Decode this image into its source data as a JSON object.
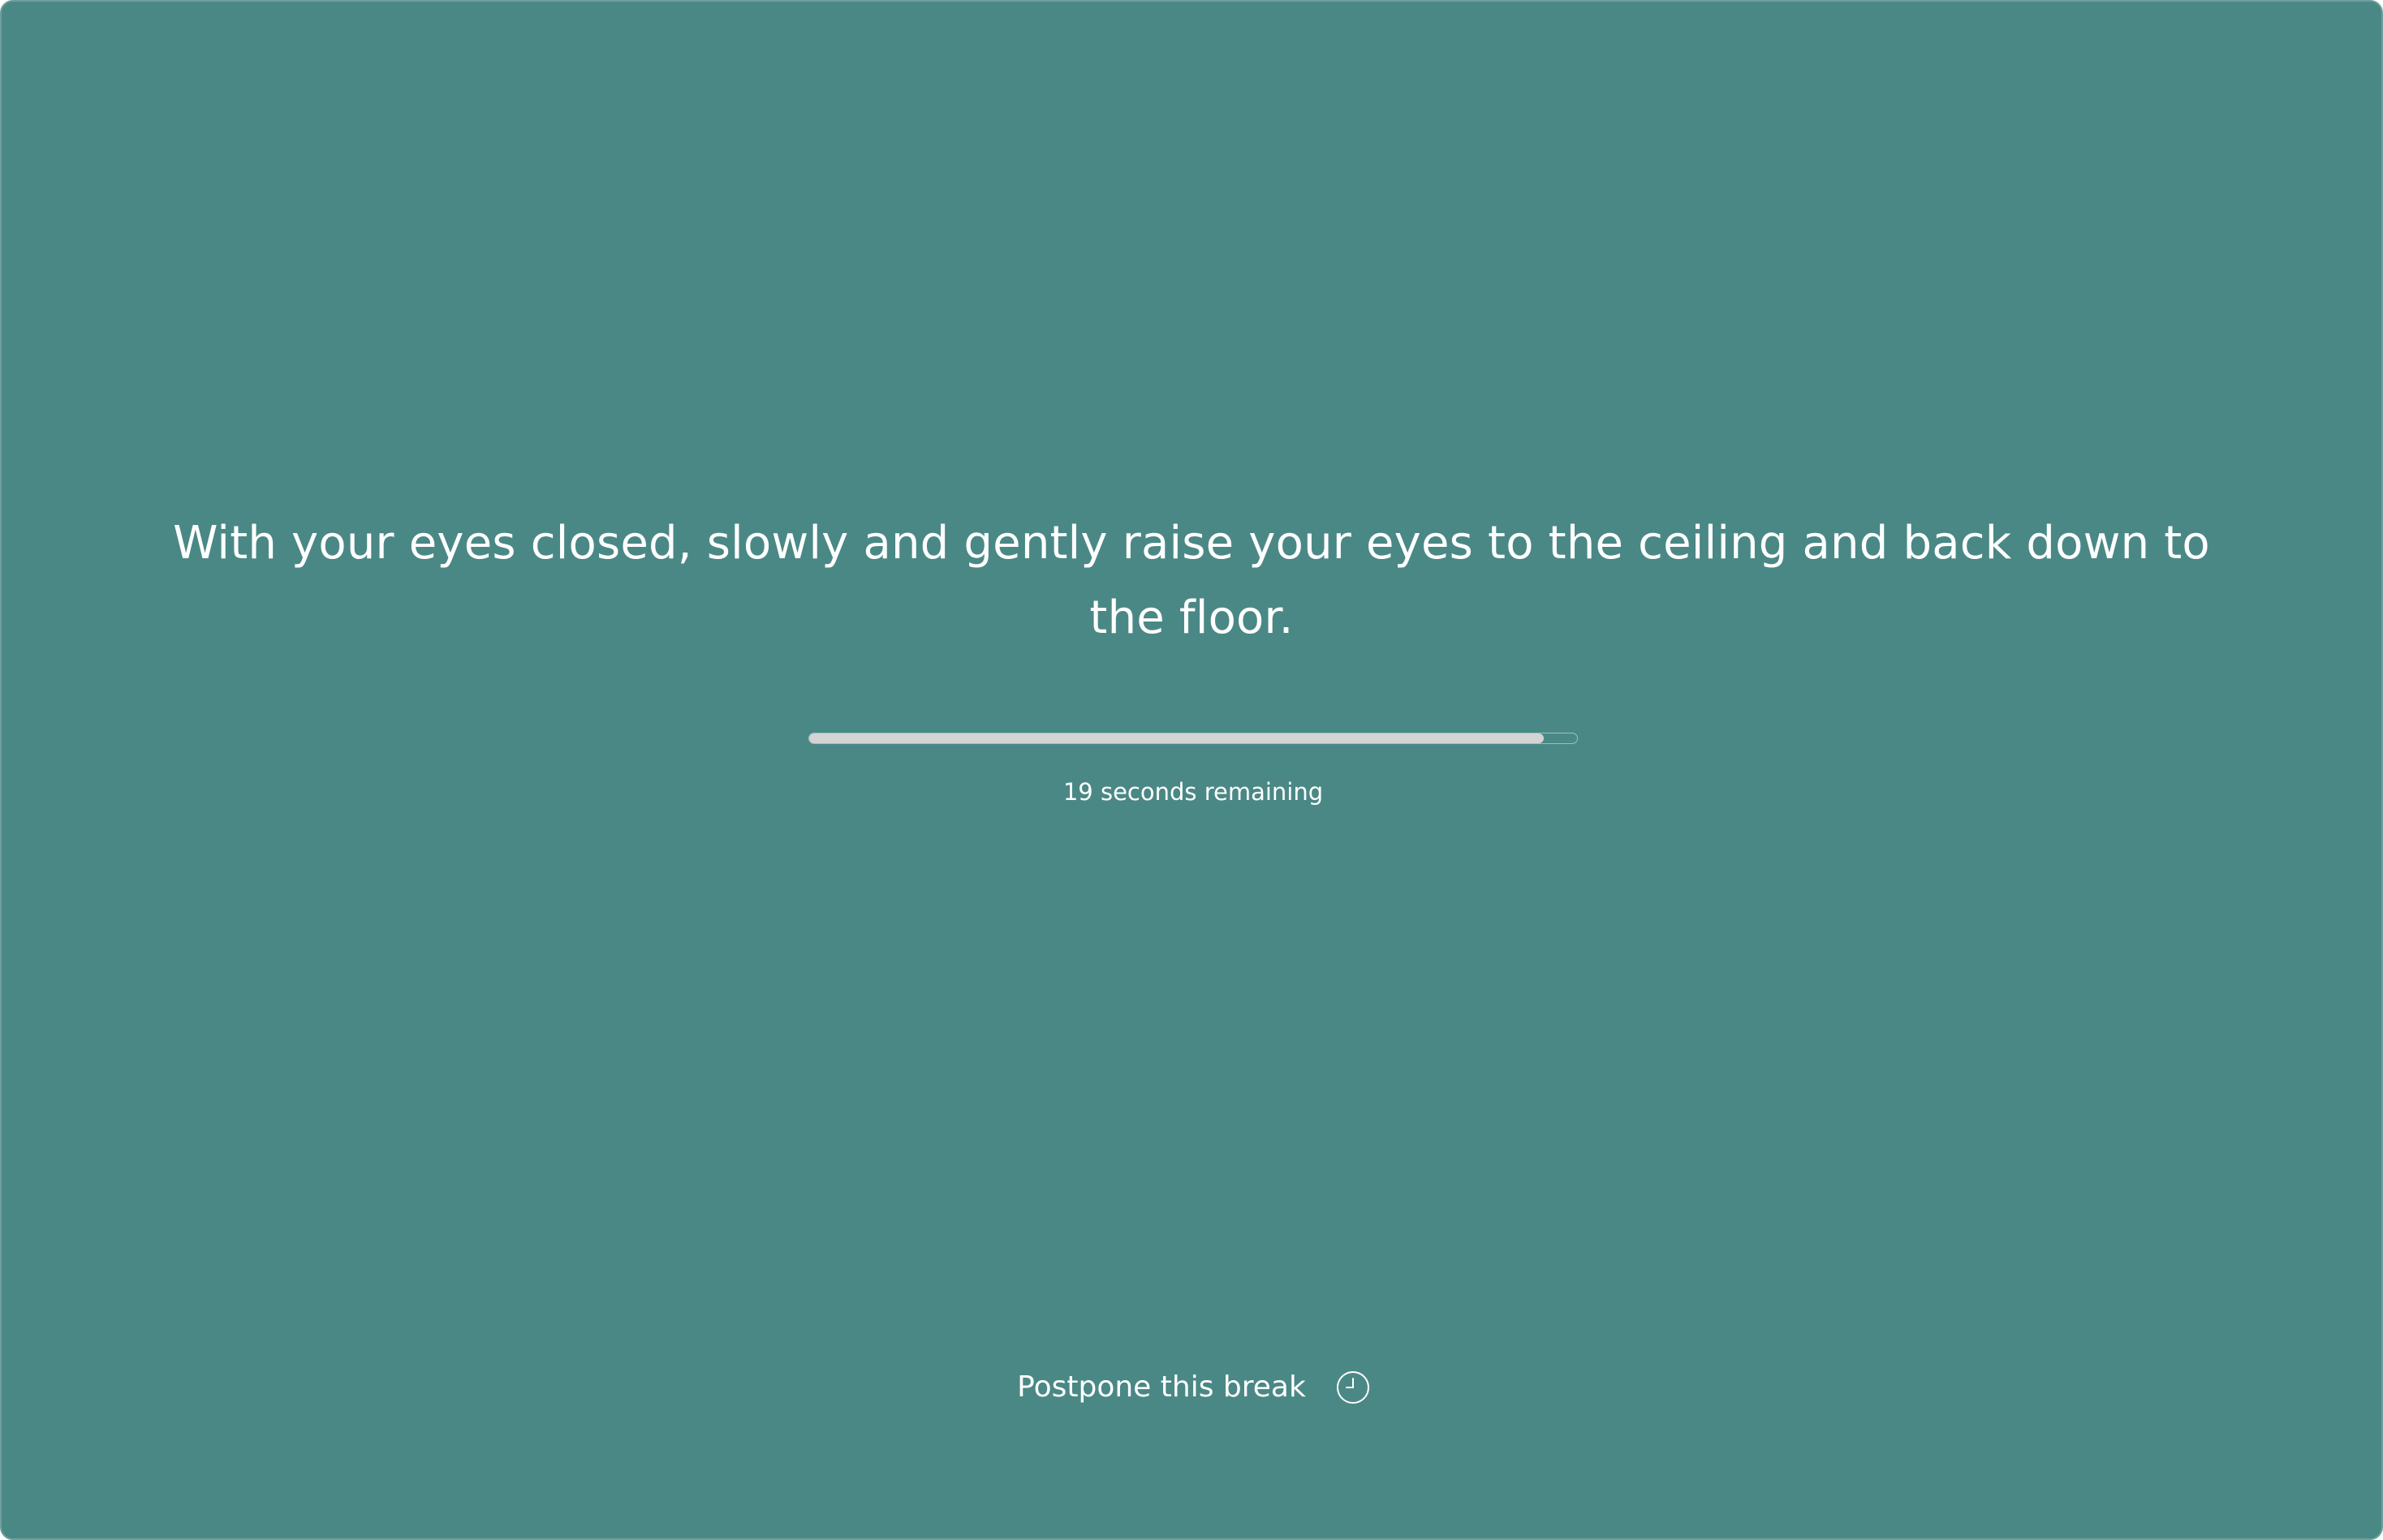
{
  "break_screen": {
    "message": "With your eyes closed, slowly and gently raise your eyes to the ceiling and back down to the floor.",
    "progress_fraction": 0.957,
    "remaining_text": "19 seconds remaining",
    "postpone_label": "Postpone this break",
    "postpone_icon": "clock-icon"
  },
  "colors": {
    "background": "#4a8886",
    "text": "#ffffff",
    "progress_fill": "#d4d4d4",
    "progress_track_border": "#9ebfbd"
  }
}
